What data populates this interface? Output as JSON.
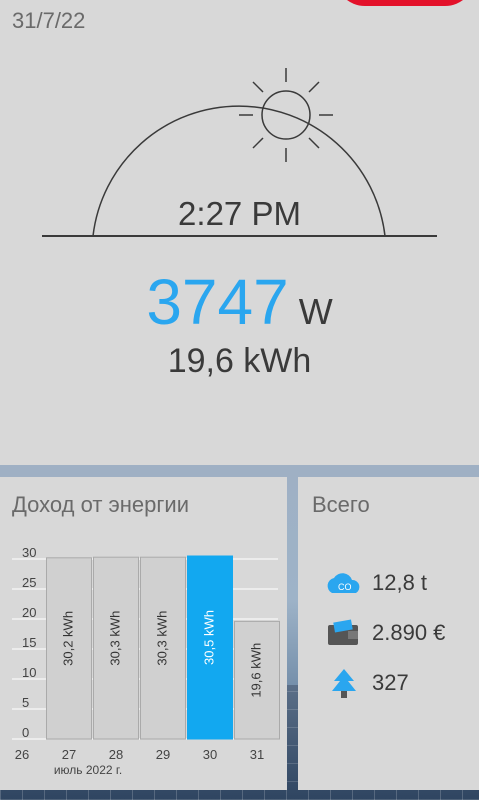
{
  "header": {
    "date": "31/7/22"
  },
  "solar": {
    "time": "2:27 PM",
    "power_value": "3747",
    "power_unit": "W",
    "energy_today": "19,6 kWh"
  },
  "income": {
    "title": "Доход от энергии",
    "month_label": "июль 2022 г."
  },
  "totals": {
    "title": "Всего",
    "items": [
      {
        "icon": "co2-cloud-icon",
        "value": "12,8 t"
      },
      {
        "icon": "wallet-icon",
        "value": "2.890 €"
      },
      {
        "icon": "tree-icon",
        "value": "327"
      }
    ]
  },
  "colors": {
    "accent": "#2aa6ef",
    "bar": "#d0d0d0",
    "highlight": "#12a8f0"
  },
  "chart_data": {
    "type": "bar",
    "categories": [
      "26",
      "27",
      "28",
      "29",
      "30",
      "31"
    ],
    "values": [
      null,
      30.2,
      30.3,
      30.3,
      30.5,
      19.6
    ],
    "labels": [
      "",
      "30,2 kWh",
      "30,3 kWh",
      "30,3 kWh",
      "30,5 kWh",
      "19,6 kWh"
    ],
    "highlight_index": 4,
    "yticks": [
      0,
      5,
      10,
      15,
      20,
      25,
      30
    ],
    "ylim": [
      0,
      31
    ],
    "xlabel": "июль 2022 г.",
    "grid": true
  }
}
